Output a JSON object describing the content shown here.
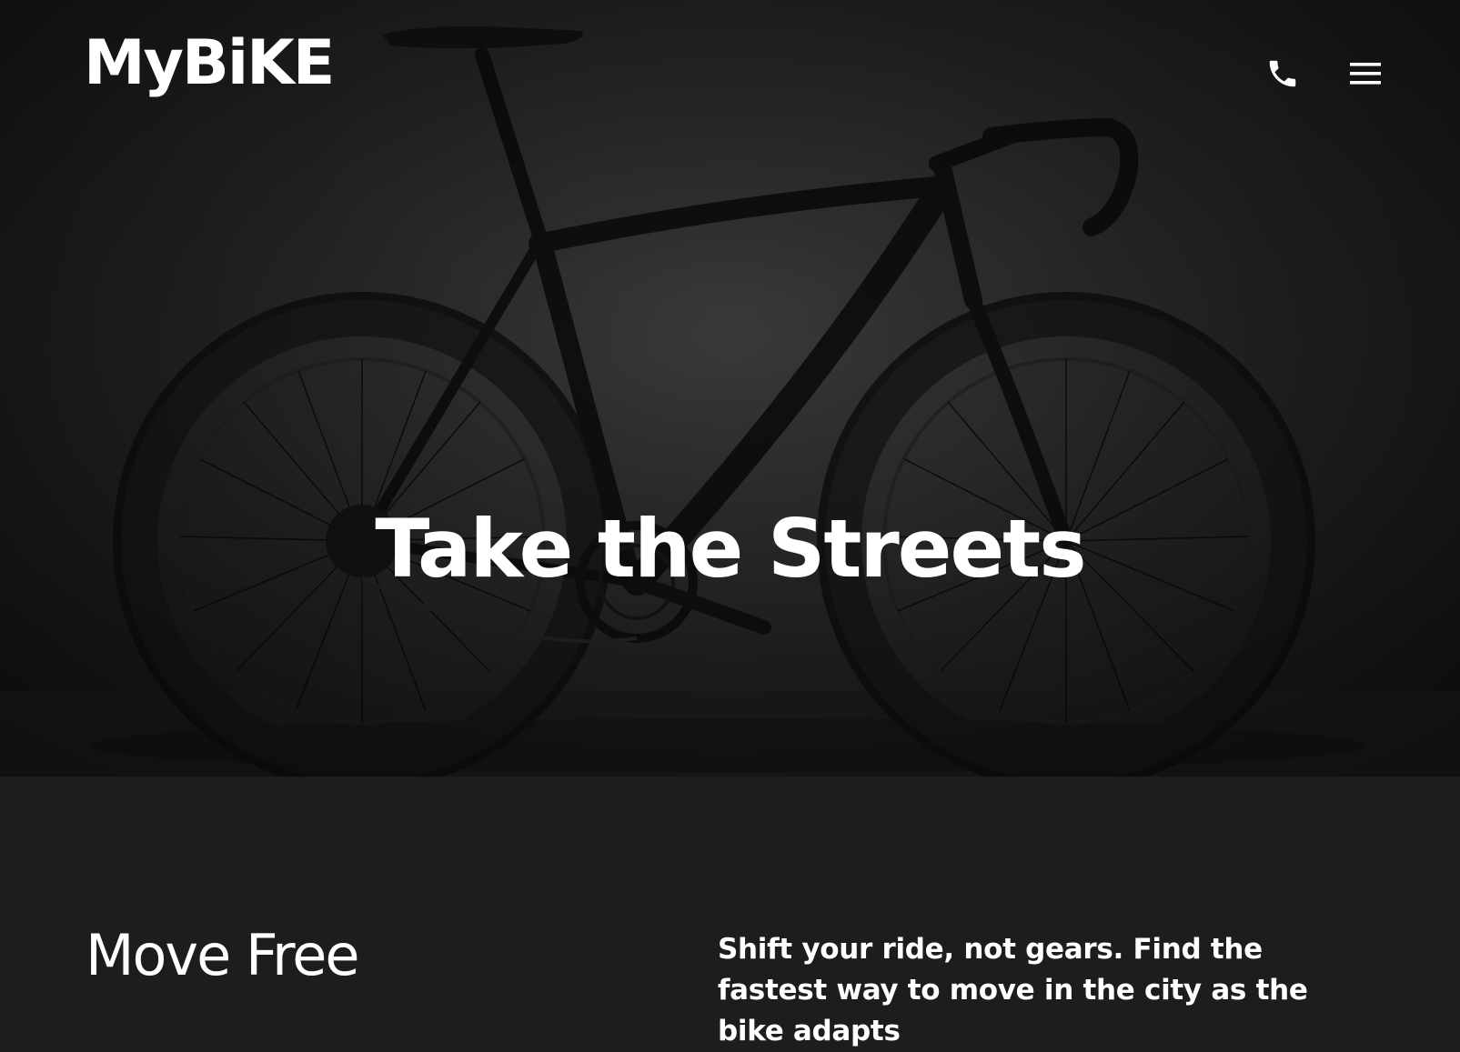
{
  "header": {
    "logo_text": "MyBiKE",
    "phone_icon": "phone-icon",
    "menu_icon": "hamburger-menu-icon"
  },
  "hero": {
    "headline": "Take the Streets",
    "image": "black-road-bike-photo"
  },
  "intro": {
    "title": "Move Free",
    "text": "Shift your ride, not gears. Find the fastest way to move in the city as the bike adapts"
  },
  "colors": {
    "background": "#1d1d1d",
    "text": "#ffffff"
  }
}
